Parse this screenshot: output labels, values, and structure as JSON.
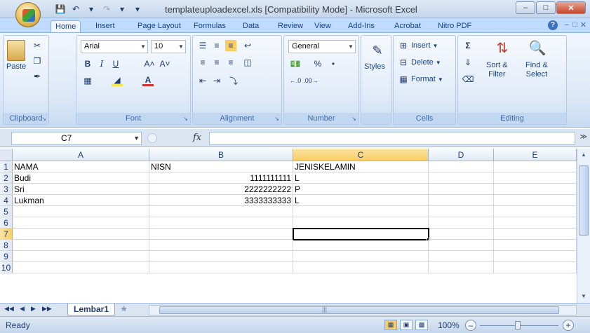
{
  "window": {
    "title": "templateuploadexcel.xls [Compatibility Mode] - Microsoft Excel"
  },
  "ribbon_tabs": [
    "Home",
    "Insert",
    "Page Layout",
    "Formulas",
    "Data",
    "Review",
    "View",
    "Add-Ins",
    "Acrobat",
    "Nitro PDF"
  ],
  "active_tab": "Home",
  "ribbon": {
    "clipboard": {
      "label": "Clipboard",
      "paste": "Paste"
    },
    "font": {
      "label": "Font",
      "name": "Arial",
      "size": "10",
      "bold": "B",
      "italic": "I",
      "underline": "U",
      "grow": "A˄",
      "shrink": "A˅",
      "font_color": "A"
    },
    "alignment": {
      "label": "Alignment"
    },
    "number": {
      "label": "Number",
      "format": "General",
      "percent": "%"
    },
    "styles": {
      "label": "Styles"
    },
    "cells": {
      "label": "Cells",
      "insert": "Insert",
      "delete": "Delete",
      "format": "Format"
    },
    "editing": {
      "label": "Editing",
      "sigma": "Σ",
      "sort": "Sort &",
      "sort2": "Filter",
      "find": "Find &",
      "find2": "Select"
    }
  },
  "formula_bar": {
    "name_box": "C7",
    "fx": "fx",
    "value": ""
  },
  "columns": [
    "A",
    "B",
    "C",
    "D",
    "E"
  ],
  "rows": [
    {
      "num": "1",
      "cells": [
        "NAMA",
        "NISN",
        "JENISKELAMIN",
        "",
        ""
      ]
    },
    {
      "num": "2",
      "cells": [
        "Budi",
        "1111111111",
        "L",
        "",
        ""
      ]
    },
    {
      "num": "3",
      "cells": [
        "Sri",
        "2222222222",
        "P",
        "",
        ""
      ]
    },
    {
      "num": "4",
      "cells": [
        "Lukman",
        "3333333333",
        "L",
        "",
        ""
      ]
    },
    {
      "num": "5",
      "cells": [
        "",
        "",
        "",
        "",
        ""
      ]
    },
    {
      "num": "6",
      "cells": [
        "",
        "",
        "",
        "",
        ""
      ]
    },
    {
      "num": "7",
      "cells": [
        "",
        "",
        "",
        "",
        ""
      ]
    },
    {
      "num": "8",
      "cells": [
        "",
        "",
        "",
        "",
        ""
      ]
    },
    {
      "num": "9",
      "cells": [
        "",
        "",
        "",
        "",
        ""
      ]
    },
    {
      "num": "10",
      "cells": [
        "",
        "",
        "",
        "",
        ""
      ]
    }
  ],
  "active_cell": {
    "row": "7",
    "col": "C"
  },
  "sheet_tabs": [
    "Lembar1"
  ],
  "status": {
    "text": "Ready",
    "zoom": "100%"
  }
}
